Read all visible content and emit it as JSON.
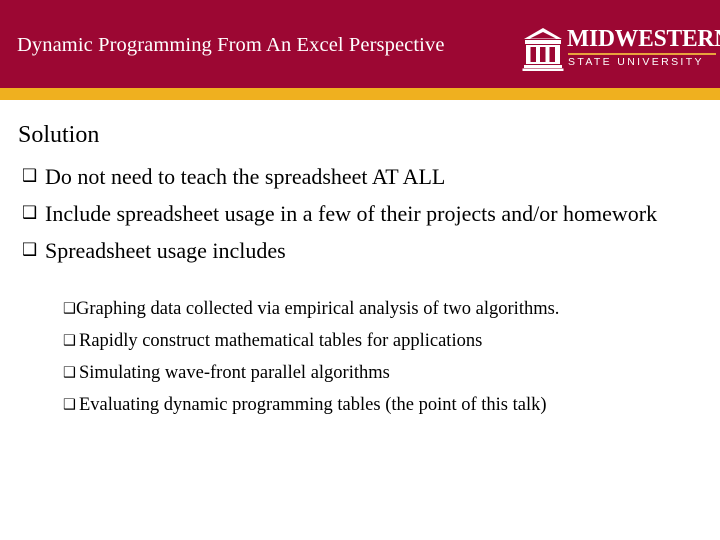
{
  "header": {
    "title": "Dynamic Programming From An Excel Perspective",
    "band_color": "#9c0733",
    "stripe_color": "#efb01f",
    "title_color": "#ffffff",
    "logo": {
      "icon": "university-building-icon",
      "word": "MIDWESTERN",
      "subtitle": "STATE UNIVERSITY",
      "rule_color": "#e8a33d"
    }
  },
  "body": {
    "heading": "Solution",
    "bullet_glyph": "❑",
    "bullets": [
      {
        "text": "Do not need to teach the spreadsheet AT ALL"
      },
      {
        "text": "Include spreadsheet usage in a few of their projects and/or homework"
      },
      {
        "text": "Spreadsheet usage includes"
      }
    ],
    "sub_bullets": [
      {
        "text": "Graphing data collected via empirical analysis of two algorithms."
      },
      {
        "text": "Rapidly construct mathematical tables for applications"
      },
      {
        "text": "Simulating wave-front parallel algorithms"
      },
      {
        "text": "Evaluating dynamic programming tables (the point of this talk)"
      }
    ]
  }
}
